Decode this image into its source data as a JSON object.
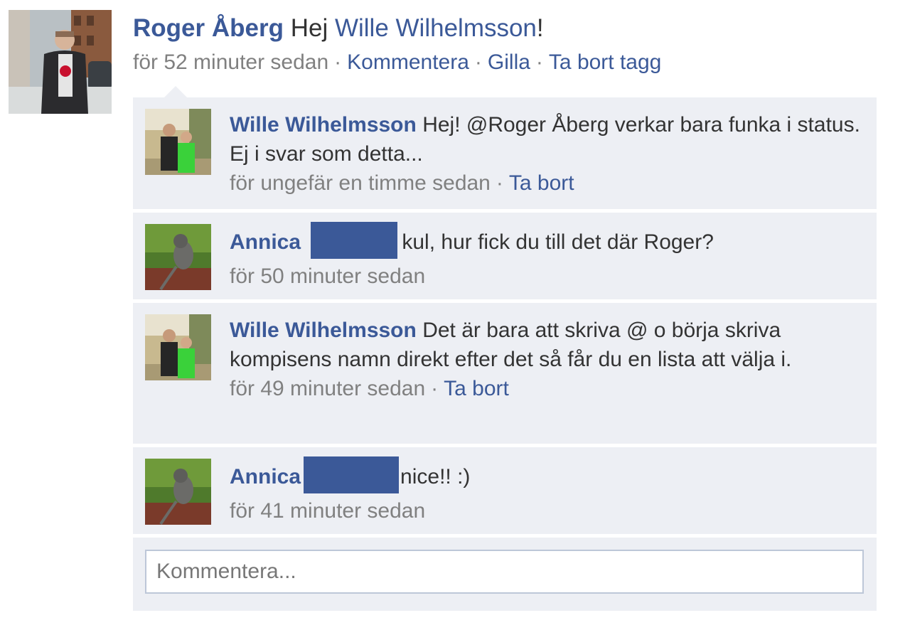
{
  "post": {
    "author": "Roger Åberg",
    "text": "Hej",
    "tagged": "Wille Wilhelmsson",
    "punct": "!",
    "time": "för 52 minuter sedan",
    "actions": [
      "Kommentera",
      "Gilla",
      "Ta bort tagg"
    ]
  },
  "comments": [
    {
      "name": "Wille Wilhelmsson",
      "text": "Hej! @Roger Åberg verkar bara funka i status. Ej i svar som detta...",
      "time": "för ungefär en timme sedan",
      "action": "Ta bort",
      "avatar": "wille"
    },
    {
      "name": "Annica",
      "text": "kul, hur fick du till det där Roger?",
      "time": "för 50 minuter sedan",
      "avatar": "annica"
    },
    {
      "name": "Wille Wilhelmsson",
      "text": "Det är bara att skriva @ o börja skriva kompisens namn direkt efter det så får du en lista att välja i.",
      "time": "för 49 minuter sedan",
      "action": "Ta bort",
      "avatar": "wille"
    },
    {
      "name": "Annica",
      "text": "nice!! :)",
      "time": "för 41 minuter sedan",
      "avatar": "annica"
    }
  ],
  "comment_box": {
    "placeholder": "Kommentera..."
  },
  "colors": {
    "link": "#3b5998",
    "meta": "#808080",
    "bubble": "#edeff4",
    "redaction": "#3b5998"
  }
}
